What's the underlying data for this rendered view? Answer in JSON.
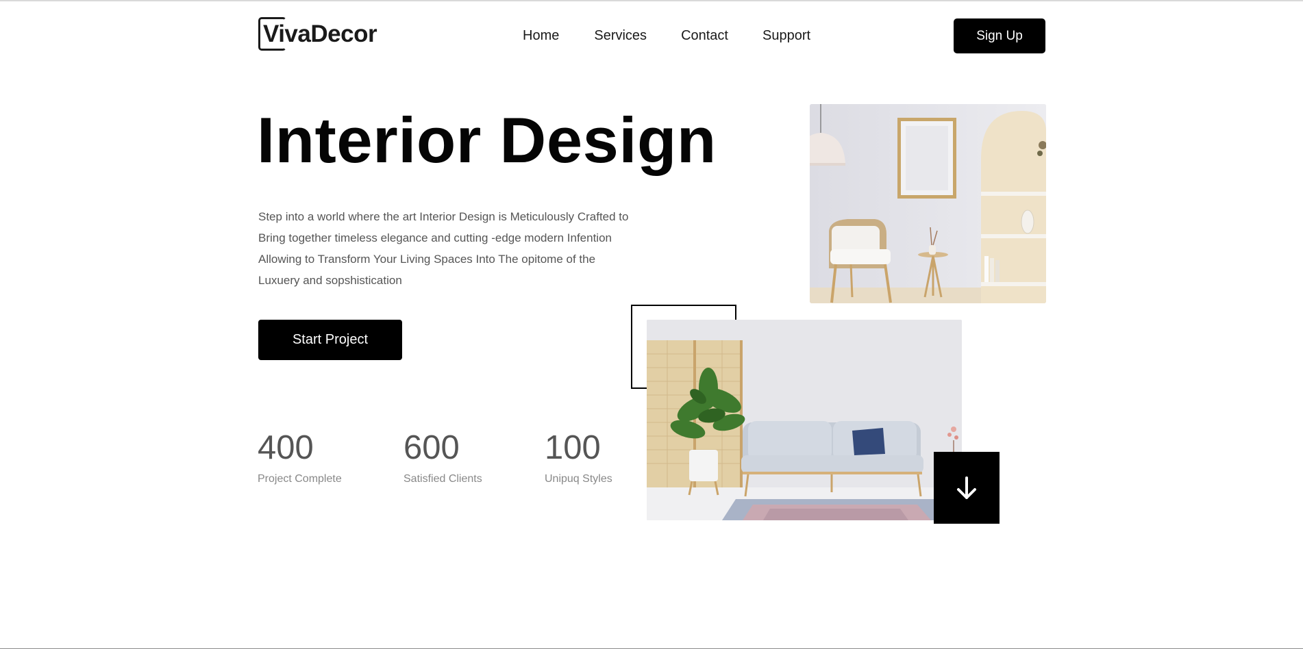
{
  "header": {
    "logo": "VivaDecor",
    "nav": [
      "Home",
      "Services",
      "Contact",
      "Support"
    ],
    "signup_label": "Sign Up"
  },
  "hero": {
    "title": "Interior Design",
    "description_lines": [
      "Step into a world where the art Interior Design is Meticulously Crafted to",
      "Bring together timeless elegance and cutting -edge modern Infention",
      "Allowing to Transform Your Living Spaces Into The opitome of the",
      "Luxuery and sopshistication"
    ],
    "cta_label": "Start Project"
  },
  "stats": [
    {
      "value": "400",
      "label": "Project Complete"
    },
    {
      "value": "600",
      "label": "Satisfied Clients"
    },
    {
      "value": "100",
      "label": "Unipuq Styles"
    }
  ],
  "icons": {
    "scroll_down": "arrow-down-icon"
  },
  "colors": {
    "primary": "#000000",
    "text_muted": "#555555",
    "label_muted": "#888888"
  }
}
